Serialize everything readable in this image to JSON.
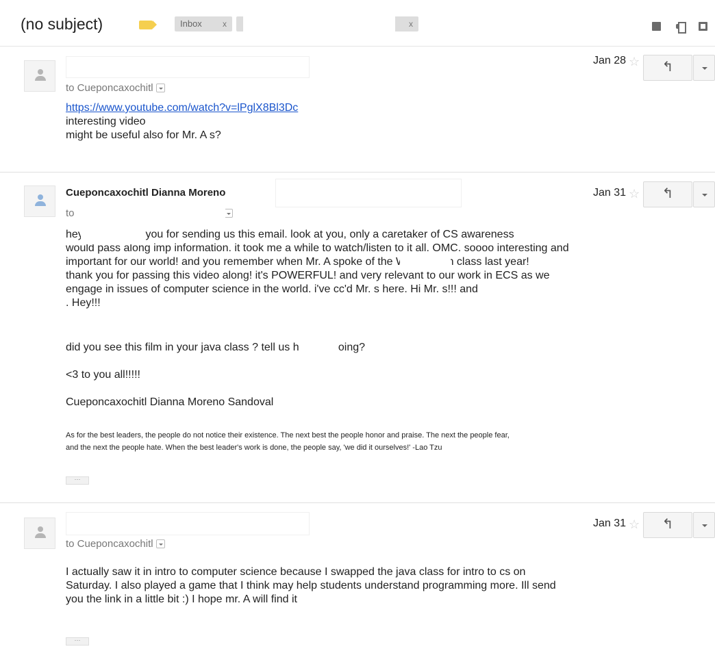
{
  "thread": {
    "subject": "(no subject)",
    "labels": [
      {
        "text": "Inbox",
        "close": "x"
      },
      {
        "text": "",
        "close": "x"
      }
    ],
    "header_icons": [
      "archive-icon",
      "print-icon",
      "new-window-icon"
    ]
  },
  "messages": [
    {
      "sender": "",
      "to_label": "to Cueponcaxochitl",
      "date": "Jan 28",
      "star": "☆",
      "reply_glyph": "↰",
      "link": "https://www.youtube.com/watch?v=lPglX8Bl3Dc",
      "lines": [
        "interesting video",
        "might be useful also for Mr. A          s?"
      ]
    },
    {
      "sender": "Cueponcaxochitl Dianna Moreno",
      "to_label": "to",
      "date": "Jan 31",
      "star": "☆",
      "reply_glyph": "↰",
      "paragraph1": [
        "hey            ,  yes! thank you for sending us this email. look at you, only a caretaker of CS awareness",
        "would pass along imp information. it took me a while to watch/listen to it all. OMC. soooo interesting and",
        "important for our world! and you remember when Mr. A            spoke of the Wikileaks in class last year!",
        "thank you for passing this video along! it's POWERFUL! and very relevant to our work in ECS as we",
        "engage in issues of computer science in the world. i've cc'd Mr.               s here. Hi Mr.               s!!! and",
        "            . Hey!!!"
      ],
      "paragraph2": "did you see this film in your java class            ? tell us how it's going?",
      "paragraph3": "<3 to you all!!!!!",
      "signature": "Cueponcaxochitl Dianna Moreno Sandoval",
      "quote_lines": [
        "As for the best leaders, the people do not notice their existence. The next best the people honor and praise. The next the people fear,",
        "and the next the people hate. When the best leader's work is done, the people say, 'we did it ourselves!'  -Lao Tzu"
      ],
      "ellipsis": "···"
    },
    {
      "sender": "",
      "to_label": "to Cueponcaxochitl",
      "date": "Jan 31",
      "star": "☆",
      "reply_glyph": "↰",
      "lines": [
        "I actually saw it in intro to computer science  because I swapped the java class for intro to cs on",
        "Saturday. I also played a game that I think may help students understand programming more. Ill send",
        "you the link   in a little bit :) I hope mr. A            will find it useful :)"
      ],
      "ellipsis": "···"
    }
  ]
}
